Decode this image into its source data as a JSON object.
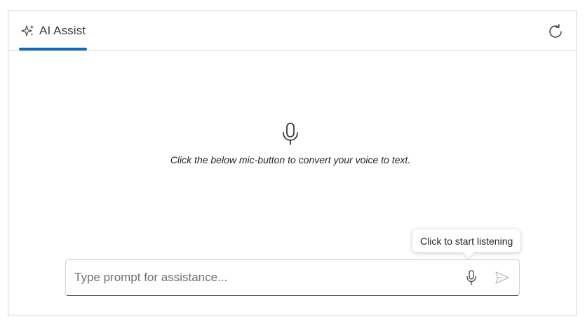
{
  "header": {
    "tab": {
      "label": "AI Assist",
      "icon": "sparkle-icon",
      "active": true
    },
    "refresh_icon": "refresh-icon"
  },
  "empty_state": {
    "icon": "microphone-icon",
    "text": "Click the below mic-button to convert your voice to text."
  },
  "tooltip": {
    "text": "Click to start listening"
  },
  "prompt": {
    "placeholder": "Type prompt for assistance...",
    "value": "",
    "mic_icon": "microphone-icon",
    "send_icon": "send-icon"
  },
  "colors": {
    "accent": "#0f6cbd",
    "border": "#d6d6d6",
    "text": "#242424",
    "placeholder": "#707070",
    "icon": "#424242",
    "send_disabled": "#bdbdbd"
  }
}
